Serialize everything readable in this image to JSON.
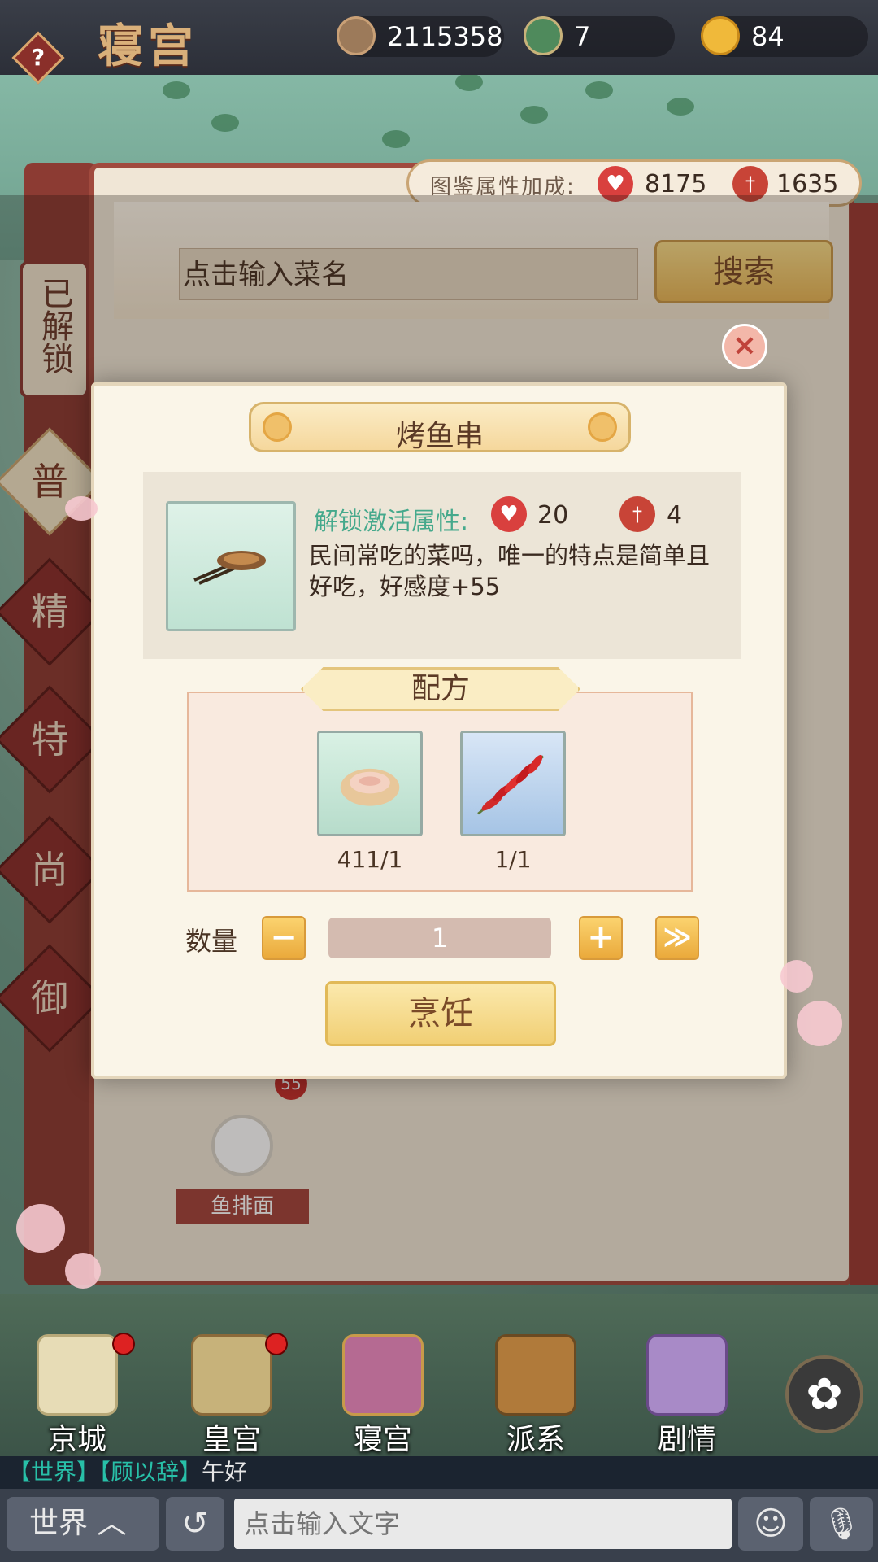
{
  "header": {
    "title": "寝宫",
    "help_label": "?",
    "resources": [
      {
        "icon": "copper-coin-icon",
        "value": "2115358"
      },
      {
        "icon": "gourd-icon",
        "value": "7"
      },
      {
        "icon": "gold-ingot-icon",
        "value": "84"
      }
    ]
  },
  "collection_bonus": {
    "label": "图鉴属性加成:",
    "affection": "8175",
    "power": "1635"
  },
  "search": {
    "placeholder": "点击输入菜名",
    "button": "搜索"
  },
  "sidebar": {
    "unlocked": "已解锁",
    "categories": [
      "普",
      "精",
      "特",
      "尚",
      "御"
    ],
    "active": "普"
  },
  "modal": {
    "title": "烤鱼串",
    "attr_label": "解锁激活属性:",
    "attr_affection": "20",
    "attr_power": "4",
    "description": "民间常吃的菜吗，唯一的特点是简单且好吃，好感度+55",
    "recipe_title": "配方",
    "ingredients": [
      {
        "icon": "fish-fillet-icon",
        "count": "411/1"
      },
      {
        "icon": "chili-pepper-icon",
        "count": "1/1"
      }
    ],
    "quantity_label": "数量",
    "minus": "−",
    "quantity": "1",
    "plus": "+",
    "max": "≫",
    "cook_button": "烹饪",
    "close": "×"
  },
  "background_card": {
    "name": "鱼排面",
    "badge": "55"
  },
  "bottom_nav": {
    "items": [
      {
        "label": "京城",
        "icon": "map-icon"
      },
      {
        "label": "皇宫",
        "icon": "palace-icon"
      },
      {
        "label": "寝宫",
        "icon": "bedchamber-icon"
      },
      {
        "label": "派系",
        "icon": "faction-icon"
      },
      {
        "label": "剧情",
        "icon": "story-book-icon"
      }
    ],
    "flower_button": "✿"
  },
  "chat": {
    "tag_channel": "【世界】",
    "tag_user": "【顾以辞】",
    "message": "午好",
    "channel_button": "世界 ︿",
    "history_icon": "↺",
    "input_placeholder": "点击输入文字",
    "emoji_icon": "☺",
    "mic_icon": "🎙"
  },
  "colors": {
    "accent_red": "#8a2e2c",
    "gold": "#f1cf74",
    "teal_text": "#45a98c"
  }
}
